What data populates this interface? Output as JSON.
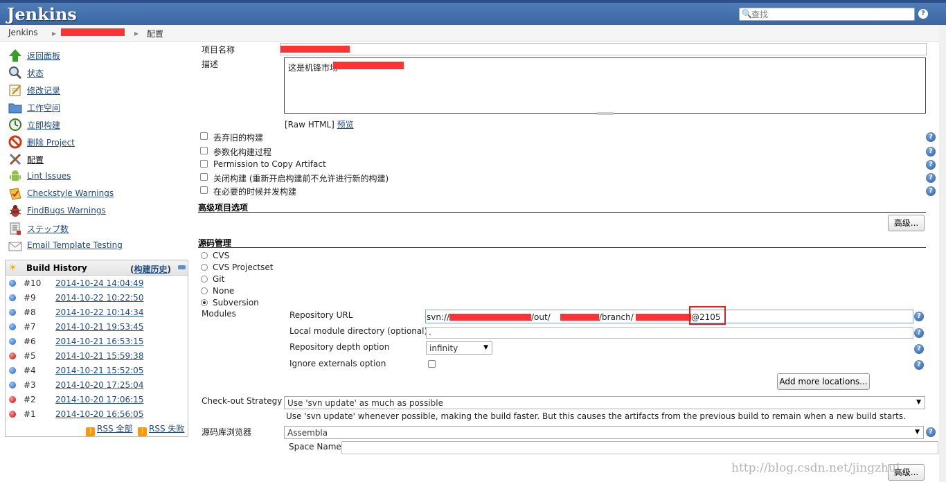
{
  "header": {
    "logo": "Jenkins",
    "search_placeholder": "查找",
    "help": "?"
  },
  "breadcrumb": {
    "root": "Jenkins",
    "current": "配置"
  },
  "sidebar": {
    "items": [
      {
        "label": "返回面板",
        "icon": "up-arrow-icon"
      },
      {
        "label": "状态",
        "icon": "magnifier-icon"
      },
      {
        "label": "修改记录",
        "icon": "notepad-icon"
      },
      {
        "label": "工作空间",
        "icon": "folder-icon"
      },
      {
        "label": "立即构建",
        "icon": "clock-icon"
      },
      {
        "label": "删除 Project",
        "icon": "no-entry-icon"
      },
      {
        "label": "配置",
        "icon": "tools-icon"
      },
      {
        "label": "Lint Issues",
        "icon": "android-icon"
      },
      {
        "label": "Checkstyle Warnings",
        "icon": "checkstyle-icon"
      },
      {
        "label": "FindBugs Warnings",
        "icon": "bug-icon"
      },
      {
        "label": "ステップ数",
        "icon": "steps-icon"
      },
      {
        "label": "Email Template Testing",
        "icon": "envelope-icon"
      }
    ]
  },
  "build_history": {
    "title": "Build History",
    "trend_label": "构建历史",
    "open_paren": "(",
    "builds": [
      {
        "num": "#10",
        "date": "2014-10-24 14:04:49",
        "status": "blue"
      },
      {
        "num": "#9",
        "date": "2014-10-22 10:22:50",
        "status": "blue"
      },
      {
        "num": "#8",
        "date": "2014-10-22 10:14:34",
        "status": "blue"
      },
      {
        "num": "#7",
        "date": "2014-10-21 19:53:45",
        "status": "blue"
      },
      {
        "num": "#6",
        "date": "2014-10-21 16:53:15",
        "status": "blue"
      },
      {
        "num": "#5",
        "date": "2014-10-21 15:59:38",
        "status": "red"
      },
      {
        "num": "#4",
        "date": "2014-10-21 15:52:05",
        "status": "blue"
      },
      {
        "num": "#3",
        "date": "2014-10-20 17:25:04",
        "status": "blue"
      },
      {
        "num": "#2",
        "date": "2014-10-20 17:06:15",
        "status": "red"
      },
      {
        "num": "#1",
        "date": "2014-10-20 16:56:05",
        "status": "red"
      }
    ],
    "rss_all": "RSS 全部",
    "rss_failed": "RSS 失败"
  },
  "form": {
    "project_name_label": "项目名称",
    "description_label": "描述",
    "description_value": "这是机锋市场",
    "raw_html": "[Raw HTML]",
    "preview": "预览",
    "options": [
      "丢弃旧的构建",
      "参数化构建过程",
      "Permission to Copy Artifact",
      "关闭构建 (重新开启构建前不允许进行新的构建)",
      "在必要的时候并发构建"
    ],
    "advanced_section": "高级项目选项",
    "advanced_button": "高级...",
    "scm_section": "源码管理",
    "scm_options": [
      "CVS",
      "CVS Projectset",
      "Git",
      "None",
      "Subversion"
    ],
    "modules_label": "Modules",
    "repo_url_label": "Repository URL",
    "repo_url_parts": [
      "svn://",
      "/out/",
      "/branch/",
      "@2105"
    ],
    "local_dir_label": "Local module directory (optional)",
    "local_dir_value": ".",
    "depth_label": "Repository depth option",
    "depth_value": "infinity",
    "ignore_label": "Ignore externals option",
    "add_more_button": "Add more locations...",
    "checkout_label": "Check-out Strategy",
    "checkout_value": "Use 'svn update' as much as possible",
    "checkout_desc": "Use 'svn update' whenever possible, making the build faster. But this causes the artifacts from the previous build to remain when a new build starts.",
    "browser_label": "源码库浏览器",
    "browser_value": "Assembla",
    "space_label": "Space Name",
    "advanced_button2": "高级...",
    "help": "?"
  },
  "watermark": "http://blog.csdn.net/jingzhui",
  "colors": {
    "header": "#3a67a3",
    "redaction": "#ff3333",
    "highlight": "#e02020"
  }
}
